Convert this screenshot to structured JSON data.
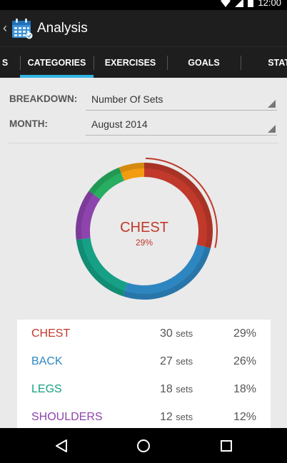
{
  "status_bar": {
    "time": "12:00",
    "icons": [
      "wifi-icon",
      "signal-icon",
      "battery-icon"
    ]
  },
  "action_bar": {
    "title": "Analysis"
  },
  "tabs": [
    {
      "label": "S"
    },
    {
      "label": "CATEGORIES",
      "selected": true
    },
    {
      "label": "EXERCISES"
    },
    {
      "label": "GOALS"
    },
    {
      "label": "STAT"
    }
  ],
  "filters": {
    "breakdown_label": "BREAKDOWN:",
    "breakdown_value": "Number Of Sets",
    "month_label": "MONTH:",
    "month_value": "August 2014"
  },
  "chart_data": {
    "type": "pie",
    "selected": "CHEST",
    "selected_pct": "29%",
    "slices": [
      {
        "label": "CHEST",
        "sets": 30,
        "pct": 29,
        "color": "#c0392b"
      },
      {
        "label": "BACK",
        "sets": 27,
        "pct": 26,
        "color": "#2e86c1"
      },
      {
        "label": "LEGS",
        "sets": 18,
        "pct": 18,
        "color": "#16a085"
      },
      {
        "label": "SHOULDERS",
        "sets": 12,
        "pct": 12,
        "color": "#8e44ad"
      },
      {
        "pct": 9,
        "color": "#27ae60"
      },
      {
        "pct": 6,
        "color": "#f39c12"
      }
    ]
  },
  "table": {
    "unit": "sets",
    "rows": [
      {
        "name": "CHEST",
        "sets": "30",
        "pct": "29%",
        "color": "#c0392b"
      },
      {
        "name": "BACK",
        "sets": "27",
        "pct": "26%",
        "color": "#2e86c1"
      },
      {
        "name": "LEGS",
        "sets": "18",
        "pct": "18%",
        "color": "#16a085"
      },
      {
        "name": "SHOULDERS",
        "sets": "12",
        "pct": "12%",
        "color": "#8e44ad"
      }
    ]
  },
  "nav_bar": {
    "buttons": [
      "back-icon",
      "home-icon",
      "recents-icon"
    ]
  }
}
